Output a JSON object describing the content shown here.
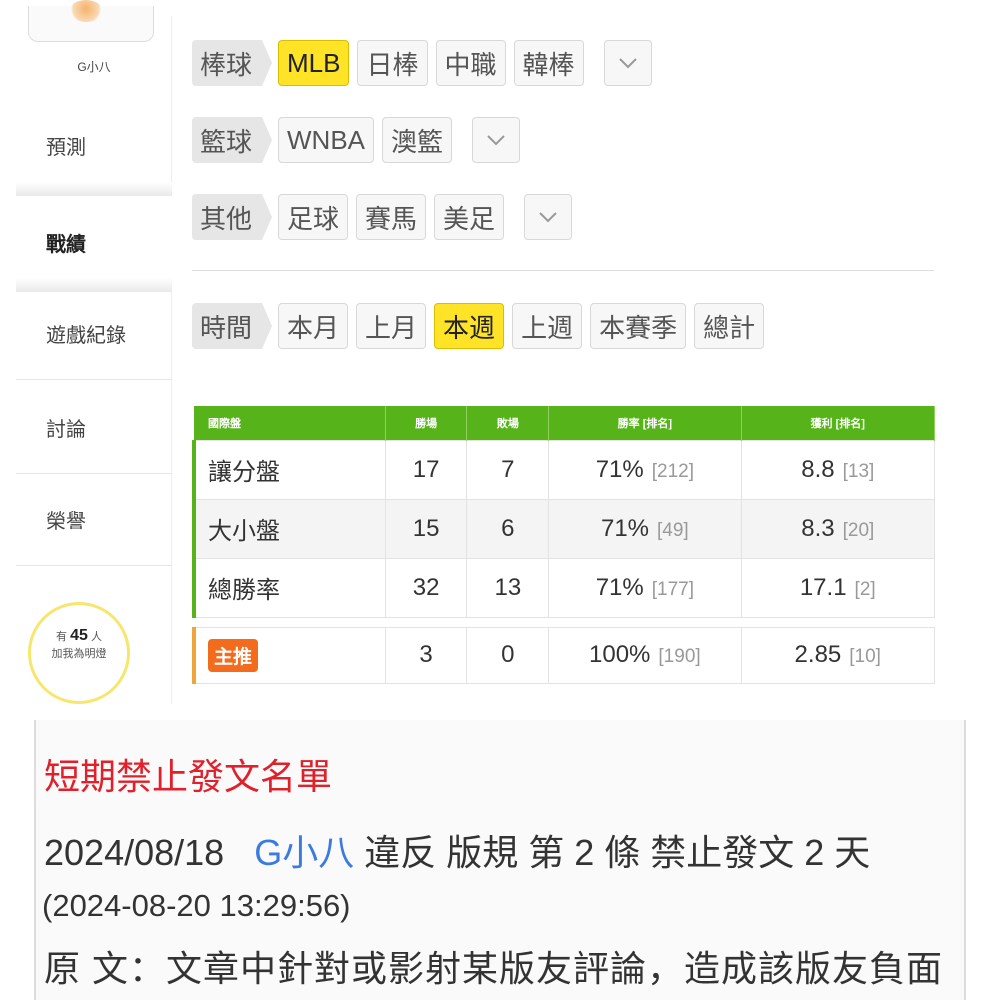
{
  "sidebar": {
    "username": "G小八",
    "items": [
      {
        "label": "預測"
      },
      {
        "label": "戰績"
      },
      {
        "label": "遊戲紀錄"
      },
      {
        "label": "討論"
      },
      {
        "label": "榮譽"
      }
    ],
    "fans": {
      "prefix": "有",
      "count": "45",
      "suffix": "人",
      "line2": "加我為明燈"
    }
  },
  "filters": {
    "baseball": {
      "label": "棒球",
      "chips": [
        "MLB",
        "日棒",
        "中職",
        "韓棒"
      ],
      "selected": "MLB"
    },
    "basketball": {
      "label": "籃球",
      "chips": [
        "WNBA",
        "澳籃"
      ]
    },
    "other": {
      "label": "其他",
      "chips": [
        "足球",
        "賽馬",
        "美足"
      ]
    },
    "time": {
      "label": "時間",
      "chips": [
        "本月",
        "上月",
        "本週",
        "上週",
        "本賽季",
        "總計"
      ],
      "selected": "本週"
    }
  },
  "table": {
    "headers": [
      "國際盤",
      "勝場",
      "敗場",
      "勝率 [排名]",
      "獲利 [排名]"
    ],
    "rows": [
      {
        "label": "讓分盤",
        "win": "17",
        "lose": "7",
        "rate": "71%",
        "rate_rank": "[212]",
        "profit": "8.8",
        "profit_rank": "[13]"
      },
      {
        "label": "大小盤",
        "win": "15",
        "lose": "6",
        "rate": "71%",
        "rate_rank": "[49]",
        "profit": "8.3",
        "profit_rank": "[20]"
      },
      {
        "label": "總勝率",
        "win": "32",
        "lose": "13",
        "rate": "71%",
        "rate_rank": "[177]",
        "profit": "17.1",
        "profit_rank": "[2]"
      }
    ],
    "featured": {
      "label": "主推",
      "win": "3",
      "lose": "0",
      "rate": "100%",
      "rate_rank": "[190]",
      "profit": "2.85",
      "profit_rank": "[10]"
    }
  },
  "ban": {
    "title": "短期禁止發文名單",
    "date": "2024/08/18",
    "user": "G小八",
    "rule": "違反 版規 第 2 條 禁止發文 2 天",
    "timestamp": "(2024-08-20 13:29:56)",
    "original": "原 文：文章中針對或影射某版友評論，造成該版友負面"
  },
  "colors": {
    "accent_green": "#56b41a",
    "selected_yellow": "#ffe326",
    "ban_red": "#e0202a",
    "link_blue": "#3a7be0"
  }
}
